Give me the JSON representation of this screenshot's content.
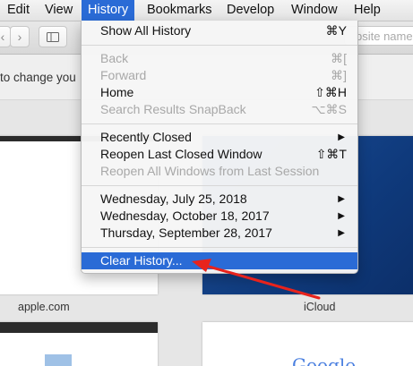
{
  "menubar": {
    "items": [
      "Edit",
      "View",
      "History",
      "Bookmarks",
      "Develop",
      "Window",
      "Help"
    ]
  },
  "toolbar": {
    "back_icon": "chevron-left-icon",
    "forward_icon": "chevron-right-icon",
    "sidebar_icon": "sidebar-icon",
    "address_placeholder": "bsite name"
  },
  "banner": {
    "text": "to change you"
  },
  "content": {
    "tile_apple_label": "apple.com",
    "tile_icloud_label": "iCloud",
    "google_text": "Google"
  },
  "history_menu": {
    "items": [
      {
        "label": "Show All History",
        "shortcut": "⌘Y"
      },
      {
        "label": "Back",
        "shortcut": "⌘["
      },
      {
        "label": "Forward",
        "shortcut": "⌘]"
      },
      {
        "label": "Home",
        "shortcut": "⇧⌘H"
      },
      {
        "label": "Search Results SnapBack",
        "shortcut": "⌥⌘S"
      },
      {
        "label": "Recently Closed",
        "shortcut": "▶"
      },
      {
        "label": "Reopen Last Closed Window",
        "shortcut": "⇧⌘T"
      },
      {
        "label": "Reopen All Windows from Last Session",
        "shortcut": ""
      },
      {
        "label": "Wednesday, July 25, 2018",
        "shortcut": "▶"
      },
      {
        "label": "Wednesday, October 18, 2017",
        "shortcut": "▶"
      },
      {
        "label": "Thursday, September 28, 2017",
        "shortcut": "▶"
      },
      {
        "label": "Clear History...",
        "shortcut": ""
      }
    ]
  },
  "colors": {
    "menu_highlight": "#2a6bd6",
    "annotation_arrow": "#e8231c"
  }
}
